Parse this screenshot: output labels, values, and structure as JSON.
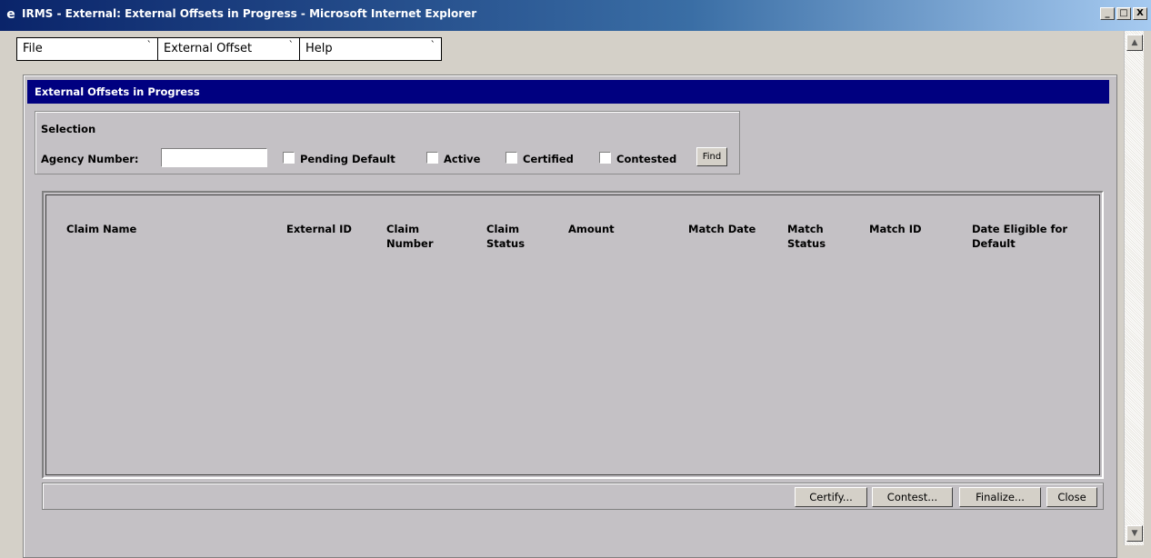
{
  "window": {
    "title": "IRMS - External: External Offsets in Progress - Microsoft Internet Explorer",
    "controls": {
      "minimize": "_",
      "maximize": "□",
      "close": "X"
    }
  },
  "menu": [
    {
      "label": "File",
      "tick": "`"
    },
    {
      "label": "External Offset",
      "tick": "`"
    },
    {
      "label": "Help",
      "tick": "`"
    }
  ],
  "panel": {
    "title": "External Offsets in Progress"
  },
  "selection": {
    "heading": "Selection",
    "agency_label": "Agency Number:",
    "agency_value": "",
    "checkboxes": [
      {
        "label": "Pending Default",
        "checked": false
      },
      {
        "label": "Active",
        "checked": false
      },
      {
        "label": "Certified",
        "checked": false
      },
      {
        "label": "Contested",
        "checked": false
      }
    ],
    "find_label": "Find"
  },
  "table": {
    "columns": [
      "Claim Name",
      "External ID",
      "Claim Number",
      "Claim Status",
      "Amount",
      "Match Date",
      "Match Status",
      "Match ID",
      "Date Eligible for Default"
    ],
    "rows": []
  },
  "buttons": {
    "certify": "Certify...",
    "contest": "Contest...",
    "finalize": "Finalize...",
    "close": "Close"
  },
  "scrollbar": {
    "up": "▲",
    "down": "▼"
  },
  "colors": {
    "header_bg": "#000080",
    "panel_bg": "#c4c1c5",
    "chrome": "#d4d0c8"
  }
}
